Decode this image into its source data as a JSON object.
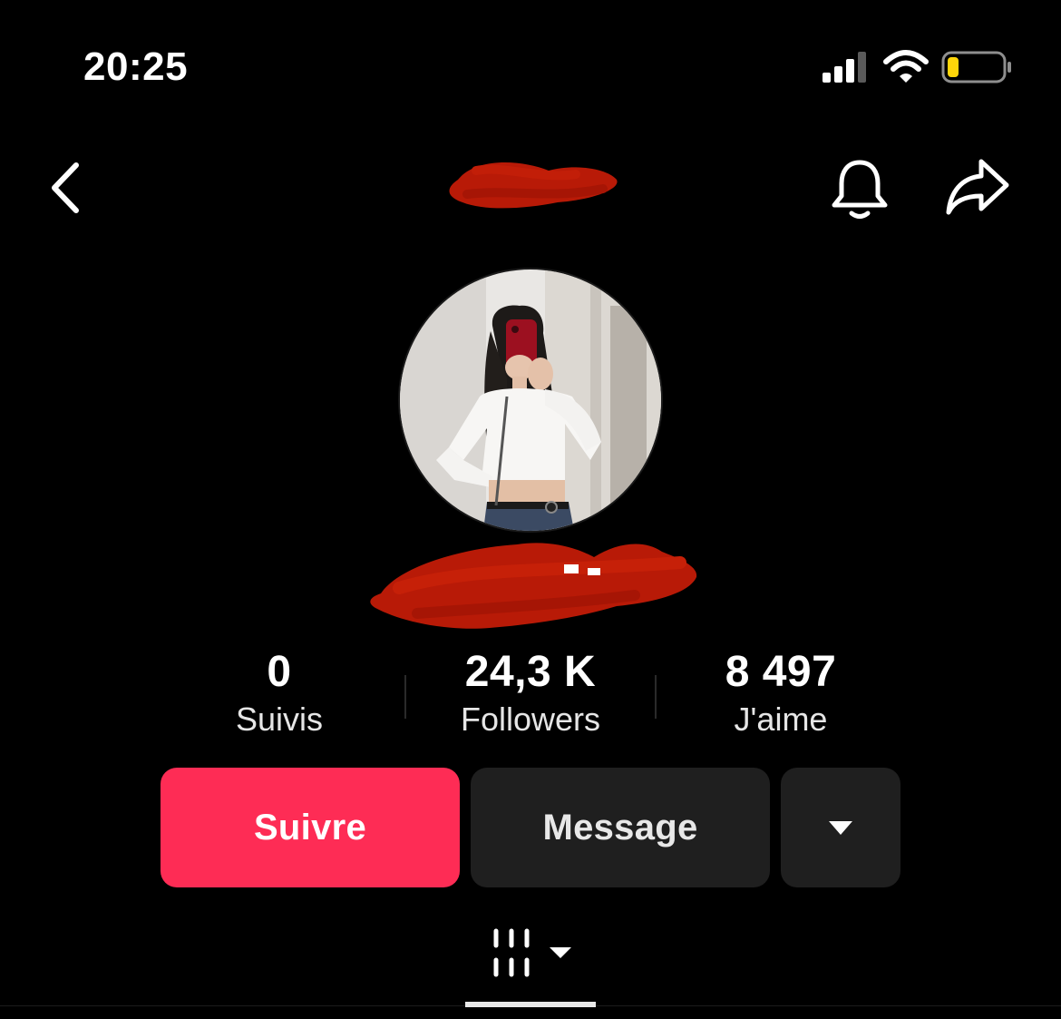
{
  "status_bar": {
    "time": "20:25",
    "signal_icon": "cellular-signal-icon",
    "wifi_icon": "wifi-icon",
    "battery_icon": "battery-low-icon",
    "battery_level": 0.2,
    "battery_color": "#ffd60a"
  },
  "nav": {
    "back_icon": "chevron-left-icon",
    "username": "",
    "notification_icon": "bell-icon",
    "share_icon": "share-arrow-icon"
  },
  "profile": {
    "display_name": "",
    "stats": [
      {
        "value": "0",
        "label": "Suivis"
      },
      {
        "value": "24,3 K",
        "label": "Followers"
      },
      {
        "value": "8 497",
        "label": "J'aime"
      }
    ]
  },
  "actions": {
    "follow_label": "Suivre",
    "message_label": "Message",
    "more_icon": "caret-down-icon"
  },
  "tabs": {
    "videos_icon": "video-grid-icon",
    "videos_dropdown_icon": "caret-down-icon"
  },
  "colors": {
    "background": "#000000",
    "accent": "#fe2c55",
    "button_dark": "#1f1f1f",
    "redaction": "#b81a07"
  }
}
